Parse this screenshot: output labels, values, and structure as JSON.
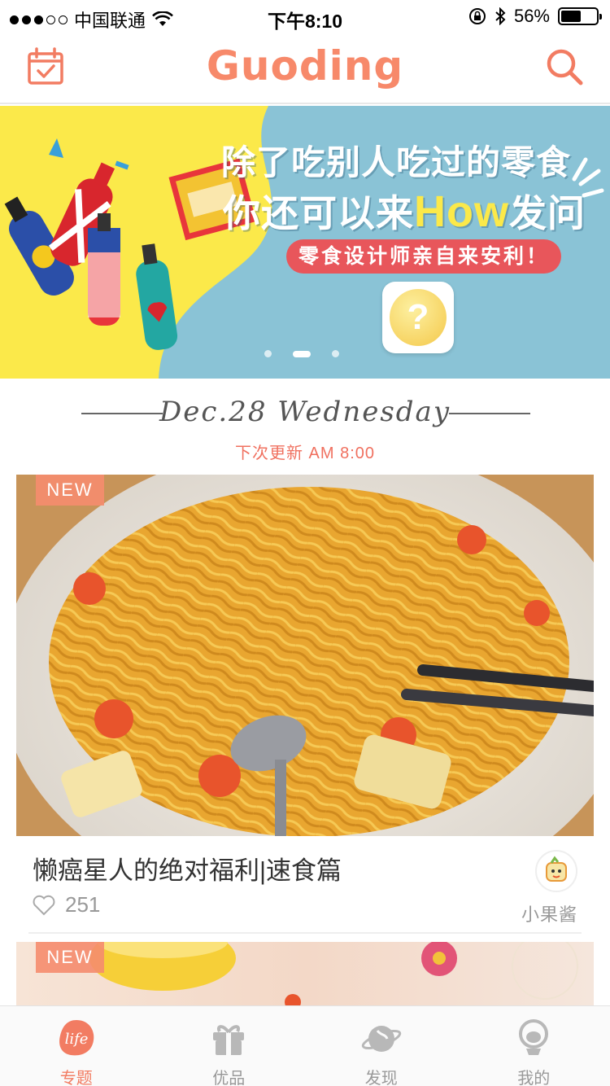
{
  "status_bar": {
    "carrier": "中国联通",
    "time": "下午8:10",
    "battery_percent": "56%",
    "battery_level": 0.56,
    "signal_bars": 3
  },
  "nav": {
    "logo": "Guoding",
    "left_icon": "calendar-check-icon",
    "right_icon": "search-icon",
    "accent_color": "#f7896a"
  },
  "banner": {
    "line1": "除了吃别人吃过的零食",
    "line2_prefix": "你还可以来",
    "line2_highlight": "How",
    "line2_suffix": "发问",
    "pill": "零食设计师亲自来安利！",
    "app_icon": "question-icon",
    "pager_count": 3,
    "pager_active": 1
  },
  "date_header": {
    "date": "Dec.28 Wednesday",
    "next_update": "下次更新 AM 8:00"
  },
  "cards": [
    {
      "badge": "NEW",
      "title": "懒癌星人的绝对福利|速食篇",
      "likes": "251",
      "author": "小果酱"
    },
    {
      "badge": "NEW"
    }
  ],
  "tab_bar": {
    "tabs": [
      {
        "label": "专题",
        "icon": "life-icon",
        "active": true,
        "icon_text": "life"
      },
      {
        "label": "优品",
        "icon": "gift-icon",
        "active": false
      },
      {
        "label": "发现",
        "icon": "planet-icon",
        "active": false
      },
      {
        "label": "我的",
        "icon": "profile-icon",
        "active": false
      }
    ]
  }
}
